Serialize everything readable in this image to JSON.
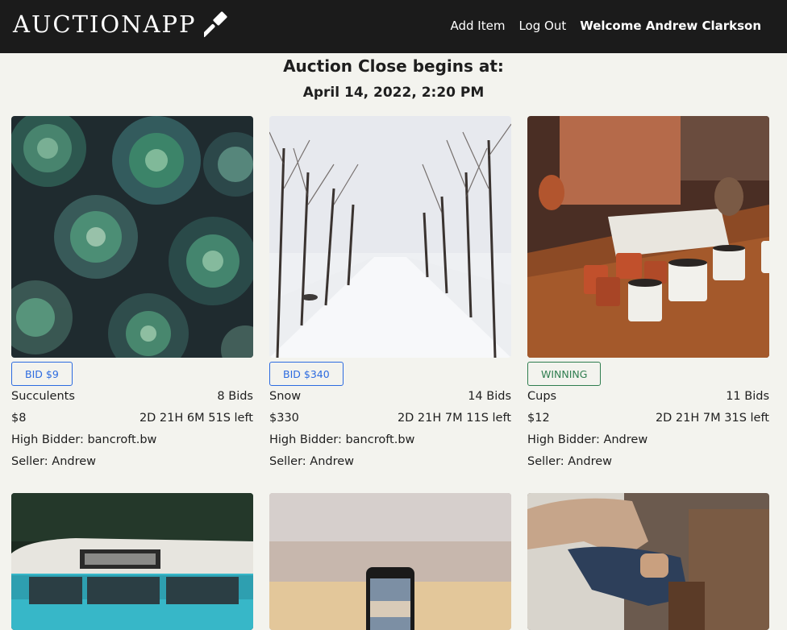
{
  "navbar": {
    "brand": "AUCTIONAPP",
    "add_item": "Add Item",
    "log_out": "Log Out",
    "welcome": "Welcome Andrew Clarkson"
  },
  "header": {
    "title": "Auction Close begins at:",
    "date": "April 14, 2022, 2:20 PM"
  },
  "items": [
    {
      "name": "Succulents",
      "bids": "8 Bids",
      "price": "$8",
      "time_left": "2D 21H 6M 51S left",
      "high_bidder": "High Bidder: bancroft.bw",
      "seller": "Seller: Andrew",
      "button": "BID $9",
      "button_state": "bid"
    },
    {
      "name": "Snow",
      "bids": "14 Bids",
      "price": "$330",
      "time_left": "2D 21H 7M 11S left",
      "high_bidder": "High Bidder: bancroft.bw",
      "seller": "Seller: Andrew",
      "button": "BID $340",
      "button_state": "bid"
    },
    {
      "name": "Cups",
      "bids": "11 Bids",
      "price": "$12",
      "time_left": "2D 21H 7M 31S left",
      "high_bidder": "High Bidder: Andrew",
      "seller": "Seller: Andrew",
      "button": "WINNING",
      "button_state": "winning"
    }
  ],
  "colors": {
    "navbar": "#1b1b1b",
    "bid": "#2c6be0",
    "winning": "#2f7d4f",
    "background": "#f3f3ee"
  },
  "icons": {
    "brand_icon": "gavel-icon"
  }
}
